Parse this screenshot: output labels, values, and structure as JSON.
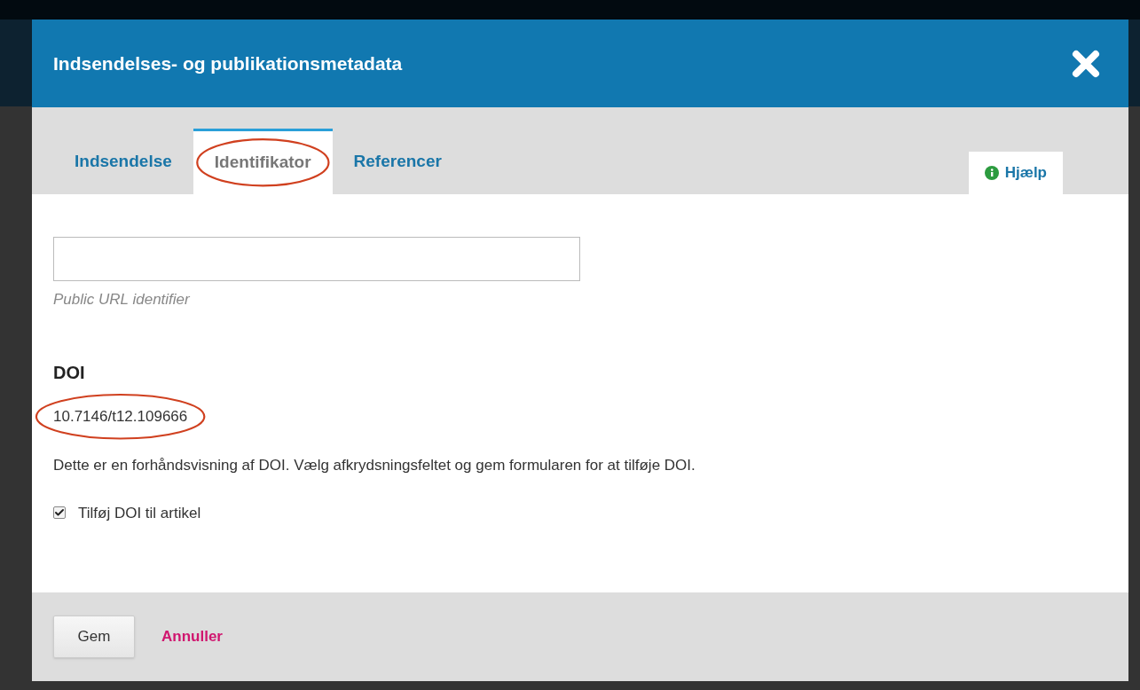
{
  "dialog": {
    "title": "Indsendelses- og publikationsmetadata"
  },
  "tabs": [
    {
      "label": "Indsendelse",
      "selected": false,
      "highlighted": false
    },
    {
      "label": "Identifikator",
      "selected": true,
      "highlighted": true
    },
    {
      "label": "Referencer",
      "selected": false,
      "highlighted": false
    }
  ],
  "help": {
    "label": "Hjælp"
  },
  "url_field": {
    "hint": "Public URL identifier"
  },
  "doi": {
    "heading": "DOI",
    "value": "10.7146/t12.109666",
    "highlighted": true,
    "description": "Dette er en forhåndsvisning af DOI. Vælg afkrydsningsfeltet og gem formularen for at tilføje DOI.",
    "checkbox": {
      "label": "Tilføj DOI til artikel",
      "checked": true
    }
  },
  "buttons": {
    "save": "Gem",
    "cancel": "Annuller"
  }
}
